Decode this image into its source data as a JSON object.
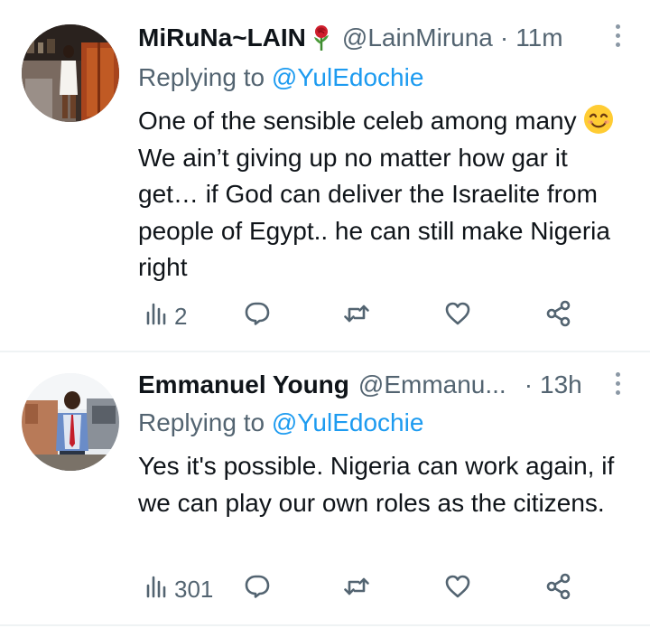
{
  "tweets": [
    {
      "name": "MiRuNa~LAIN",
      "name_emoji": "rose-icon",
      "handle": "@LainMiruna",
      "separator": "·",
      "time": "11m",
      "replying_prefix": "Replying to",
      "replying_to": "@YulEdochie",
      "text_start": "One of the sensible celeb among many",
      "text_emoji": "smiling-face-emoji",
      "text_end": "We ain’t giving up no matter how gar it get… if God can deliver the Israelite from people of Egypt.. he can still make Nigeria right",
      "views": "2",
      "replies": "",
      "retweets": "",
      "likes": ""
    },
    {
      "name": "Emmanuel Young",
      "handle": "@Emmanu...",
      "separator": "·",
      "time": "13h",
      "replying_prefix": "Replying to",
      "replying_to": "@YulEdochie",
      "text": "Yes it's possible. Nigeria can work again, if we can play our own roles as the citizens.",
      "views": "301",
      "replies": "",
      "retweets": "",
      "likes": ""
    }
  ],
  "colors": {
    "text": "#0f1419",
    "secondary": "#536471",
    "link": "#1d9bf0",
    "divider": "#eff3f4"
  },
  "icons": [
    "views-icon",
    "reply-icon",
    "retweet-icon",
    "like-icon",
    "share-icon",
    "more-icon"
  ]
}
